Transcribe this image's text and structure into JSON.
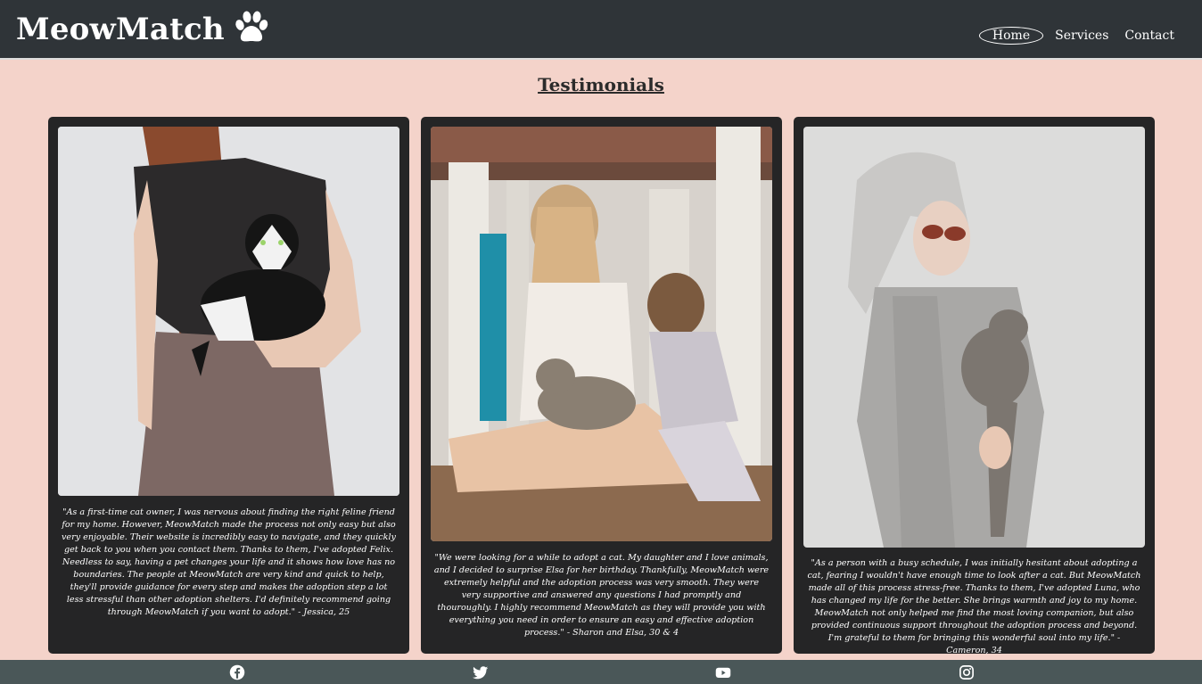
{
  "brand": {
    "name": "MeowMatch",
    "icon": "paw-icon"
  },
  "nav": {
    "items": [
      {
        "label": "Home",
        "active": true
      },
      {
        "label": "Services"
      },
      {
        "label": "Contact"
      }
    ]
  },
  "page": {
    "title": "Testimonials"
  },
  "testimonials": [
    {
      "photo": "woman-holding-black-white-cat",
      "quote": "\"As a first-time cat owner, I was nervous about finding the right feline friend for my home. However, MeowMatch made the process not only easy but also very enjoyable. Their website is incredibly easy to navigate, and they quickly get back to you when you contact them. Thanks to them, I've adopted Felix. Needless to say, having a pet changes your life and it shows how love has no boundaries. The people at MeowMatch are very kind and quick to help, they'll provide guidance for every step and makes the adoption step a lot less stressful than other adoption shelters. I'd definitely recommend going through MeowMatch if you want to adopt.\" - Jessica, 25"
    },
    {
      "photo": "mother-daughter-with-tabby-cat",
      "quote": "\"We were looking for a while to adopt a cat. My daughter and I love animals, and I decided to surprise Elsa for her birthday. Thankfully, MeowMatch were extremely helpful and the adoption process was very smooth. They were very supportive and answered any questions I had promptly and thouroughly. I highly recommend MeowMatch as they will provide you with everything you need in order to ensure an easy and effective adoption process.\" - Sharon and Elsa, 30 & 4"
    },
    {
      "photo": "older-woman-in-robe-with-grey-cat",
      "quote": "\"As a person with a busy schedule, I was initially hesitant about adopting a cat, fearing I wouldn't have enough time to look after a cat. But MeowMatch made all of this process stress-free. Thanks to them, I've adopted Luna, who has changed my life for the better. She brings warmth and joy to my home. MeowMatch not only helped me find the most loving companion, but also provided continuous support throughout the adoption process and beyond. I'm grateful to them for bringing this wonderful soul into my life.\" - Cameron, 34"
    }
  ],
  "footer": {
    "social": [
      "facebook-icon",
      "twitter-icon",
      "youtube-icon",
      "instagram-icon"
    ]
  },
  "colors": {
    "header": "#2f3438",
    "background": "#f4d3ca",
    "card": "#252526",
    "footer": "#4a5758"
  }
}
